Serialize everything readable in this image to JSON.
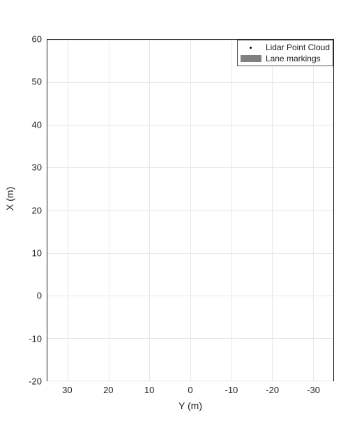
{
  "chart_data": {
    "type": "scatter",
    "title": "",
    "xlabel": "Y (m)",
    "ylabel": "X (m)",
    "x_axis": {
      "ticks": [
        30,
        20,
        10,
        0,
        -10,
        -20,
        -30
      ],
      "range": [
        35,
        -35
      ],
      "direction": "reverse"
    },
    "y_axis": {
      "ticks": [
        -20,
        -10,
        0,
        10,
        20,
        30,
        40,
        50,
        60
      ],
      "range": [
        -20,
        60
      ]
    },
    "series": [
      {
        "name": "Lidar Point Cloud",
        "type": "scatter",
        "marker": "dot",
        "color": "#000000",
        "x": [],
        "y": []
      },
      {
        "name": "Lane markings",
        "type": "area",
        "color": "#808080",
        "x": [],
        "y": []
      }
    ],
    "grid": true
  },
  "legend": {
    "entries": [
      {
        "label": "Lidar Point Cloud",
        "kind": "dot"
      },
      {
        "label": "Lane markings",
        "kind": "bar"
      }
    ]
  },
  "axis_labels": {
    "x": "Y (m)",
    "y": "X (m)"
  },
  "tick_labels": {
    "x": [
      "30",
      "20",
      "10",
      "0",
      "-10",
      "-20",
      "-30"
    ],
    "y": [
      "-20",
      "-10",
      "0",
      "10",
      "20",
      "30",
      "40",
      "50",
      "60"
    ]
  }
}
